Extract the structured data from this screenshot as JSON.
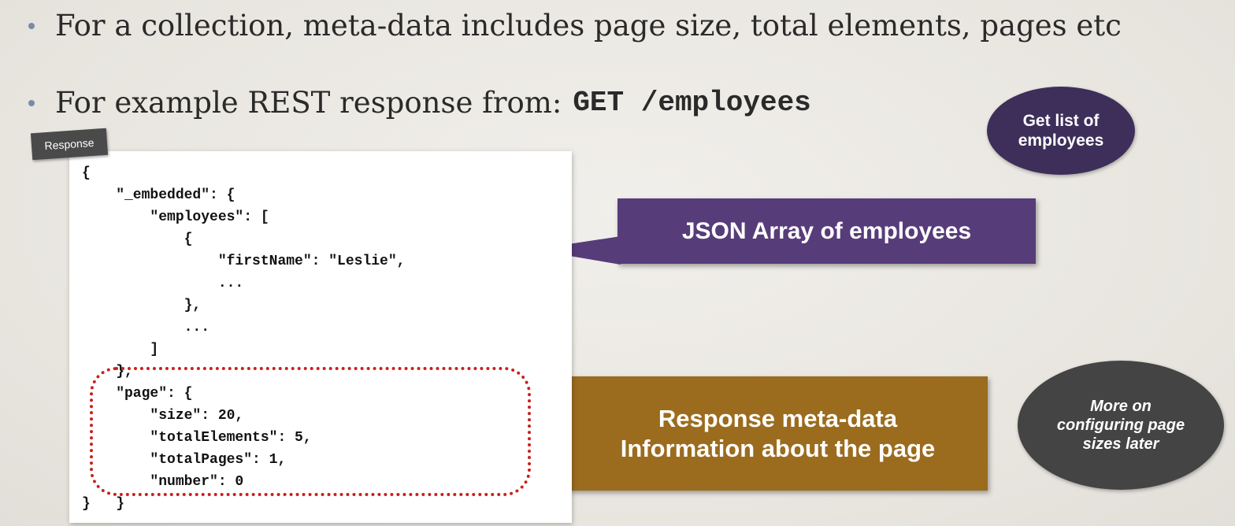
{
  "bullets": [
    {
      "text": "For a collection, meta-data includes page size, total elements, pages etc"
    },
    {
      "text": "For example REST response from:",
      "code": "GET /employees"
    }
  ],
  "response_tag": "Response",
  "code_lines": [
    "{",
    "    \"_embedded\": {",
    "        \"employees\": [",
    "            {",
    "                \"firstName\": \"Leslie\",",
    "                ...",
    "            },",
    "            ...",
    "        ]",
    "    },",
    "    \"page\": {",
    "        \"size\": 20,",
    "        \"totalElements\": 5,",
    "        \"totalPages\": 1,",
    "        \"number\": 0",
    "    }",
    "}"
  ],
  "callouts": {
    "json_array": "JSON Array of employees",
    "meta_line1": "Response meta-data",
    "meta_line2": "Information about the page"
  },
  "bubbles": {
    "employees_line1": "Get list of",
    "employees_line2": "employees",
    "later_line1": "More on",
    "later_line2": "configuring page",
    "later_line3": "sizes later"
  },
  "colors": {
    "bullet": "#7b8aa8",
    "json_callout": "#573c7a",
    "meta_callout": "#9b6c1e",
    "employees_bubble": "#3d2f5a",
    "later_bubble": "#444444",
    "highlight_border": "#c8201e"
  }
}
